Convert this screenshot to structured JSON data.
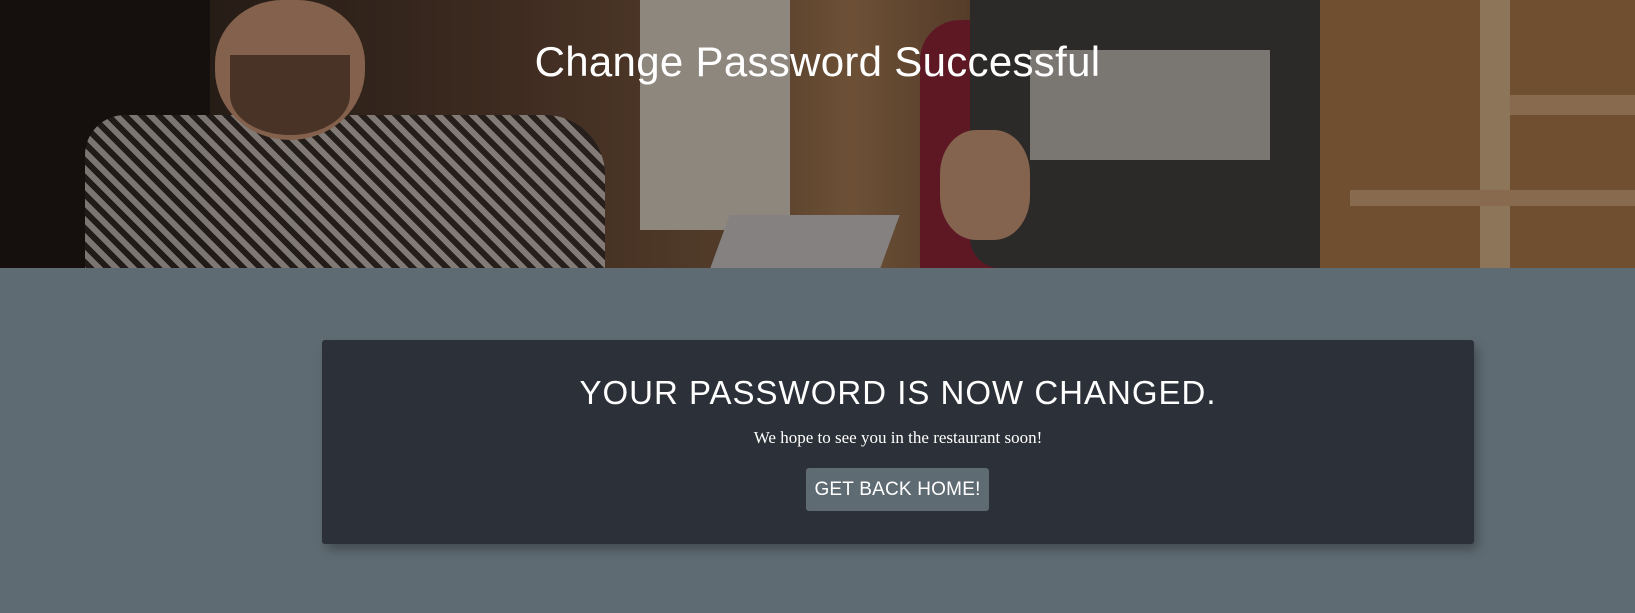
{
  "hero": {
    "title": "Change Password Successful",
    "image_alt_icon": "hero-photo"
  },
  "card": {
    "heading": "YOUR PASSWORD IS NOW CHANGED.",
    "message": "We hope to see you in the restaurant soon!",
    "button_label": "GET BACK HOME!"
  },
  "colors": {
    "page_background": "#5f6b73",
    "card_background": "#2c3038",
    "button_background": "#5f6b73",
    "text": "#ffffff"
  }
}
